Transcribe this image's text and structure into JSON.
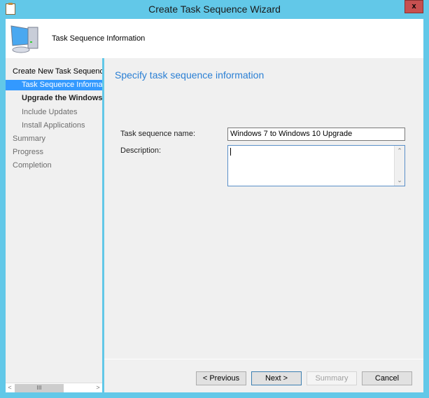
{
  "window": {
    "title": "Create Task Sequence Wizard",
    "close_label": "x"
  },
  "header": {
    "title": "Task Sequence Information",
    "icon": "computer-icon"
  },
  "nav": [
    {
      "label": "Create New Task Sequence",
      "level": "top",
      "state": "normal"
    },
    {
      "label": "Task Sequence Information",
      "level": "sub",
      "state": "selected"
    },
    {
      "label": "Upgrade the Windows Operating System",
      "level": "sub",
      "state": "bold"
    },
    {
      "label": "Include Updates",
      "level": "sub",
      "state": "dim"
    },
    {
      "label": "Install Applications",
      "level": "sub",
      "state": "dim"
    },
    {
      "label": "Summary",
      "level": "top",
      "state": "dim"
    },
    {
      "label": "Progress",
      "level": "top",
      "state": "dim"
    },
    {
      "label": "Completion",
      "level": "top",
      "state": "dim"
    }
  ],
  "main": {
    "heading": "Specify task sequence information",
    "name_label": "Task sequence name:",
    "name_value": "Windows 7 to Windows 10 Upgrade",
    "description_label": "Description:",
    "description_value": ""
  },
  "buttons": {
    "previous": "< Previous",
    "next": "Next >",
    "summary": "Summary",
    "cancel": "Cancel"
  },
  "colors": {
    "frame": "#62c8e8",
    "selection": "#3399ff",
    "heading": "#2a7fd4",
    "close": "#c75050"
  }
}
